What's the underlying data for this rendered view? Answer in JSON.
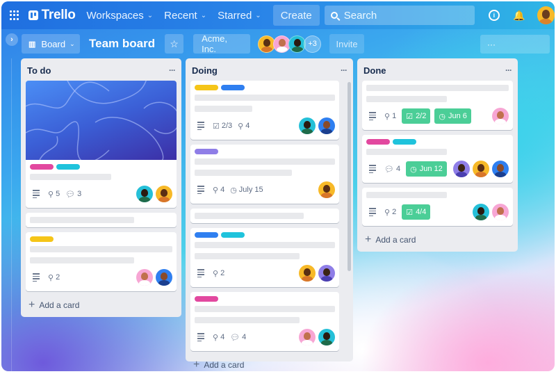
{
  "topbar": {
    "app_name": "Trello",
    "nav": [
      {
        "label": "Workspaces"
      },
      {
        "label": "Recent"
      },
      {
        "label": "Starred"
      }
    ],
    "create_label": "Create",
    "search_placeholder": "Search"
  },
  "board": {
    "view_label": "Board",
    "title": "Team board",
    "workspace_label": "Acme, Inc.",
    "members_more": "+3",
    "invite_label": "Invite",
    "more_label": "···"
  },
  "colors": {
    "label_pink": "#e2489f",
    "label_cyan": "#1fc3dc",
    "label_yellow": "#f5c518",
    "label_blue": "#2f7ff0",
    "label_purple": "#8f7ee7",
    "badge_green": "#4bce97"
  },
  "lists": [
    {
      "title": "To do",
      "menu": "···",
      "add_label": "Add a card",
      "cards": [
        {
          "cover": true,
          "labels": [
            "pink",
            "cyan"
          ],
          "attachments": "5",
          "comments": "3",
          "members": [
            "teal",
            "yellow"
          ]
        },
        {
          "labels": [],
          "members": []
        },
        {
          "labels": [
            "yellow"
          ],
          "attachments": "2",
          "members": [
            "pink",
            "blue"
          ]
        }
      ]
    },
    {
      "title": "Doing",
      "menu": "···",
      "add_label": "Add a card",
      "cards": [
        {
          "labels": [
            "yellow",
            "blue"
          ],
          "checklist": "2/3",
          "attachments": "4",
          "members": [
            "teal",
            "blue"
          ]
        },
        {
          "labels": [
            "purple"
          ],
          "attachments": "4",
          "due": "July 15",
          "members": [
            "yellow"
          ]
        },
        {
          "labels": [],
          "members": []
        },
        {
          "labels": [
            "blue",
            "cyan"
          ],
          "attachments": "2",
          "members": [
            "yellow",
            "purple"
          ]
        },
        {
          "labels": [
            "pink"
          ],
          "attachments": "4",
          "comments": "4",
          "members": [
            "pink",
            "teal"
          ]
        }
      ]
    },
    {
      "title": "Done",
      "menu": "···",
      "add_label": "Add a card",
      "cards": [
        {
          "labels": [],
          "attachments": "1",
          "checklist_done": "2/2",
          "due_done": "Jun 6",
          "members": [
            "pink"
          ]
        },
        {
          "labels": [
            "pink",
            "cyan"
          ],
          "comments": "4",
          "due_done": "Jun 12",
          "members": [
            "purple",
            "yellow",
            "blue"
          ]
        },
        {
          "labels": [],
          "attachments": "2",
          "checklist_done": "4/4",
          "members": [
            "teal",
            "pink"
          ]
        }
      ]
    }
  ]
}
